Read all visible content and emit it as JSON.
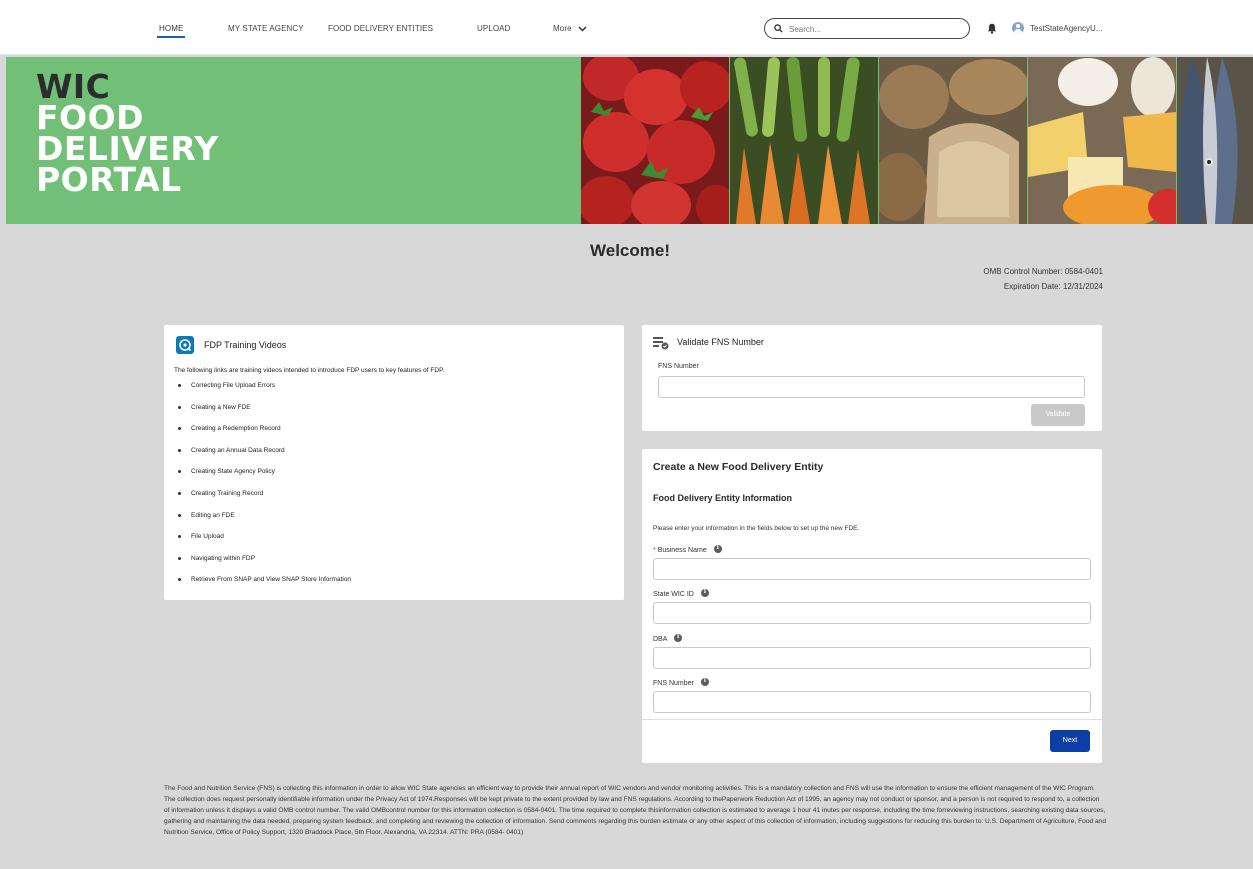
{
  "nav": {
    "items": [
      "HOME",
      "MY STATE AGENCY",
      "FOOD DELIVERY ENTITIES",
      "UPLOAD"
    ],
    "more_label": "More",
    "search_placeholder": "Search...",
    "username": "TestStateAgencyU..."
  },
  "banner": {
    "line1": "WIC",
    "line2": "FOOD",
    "line3": "DELIVERY",
    "line4": "PORTAL"
  },
  "welcome": {
    "title": "Welcome!",
    "omb_line": "OMB Control Number: 0584-0401",
    "expiration_line": "Expiration Date: 12/31/2024"
  },
  "training": {
    "title": "FDP Training Videos",
    "intro": "The following links are training videos intended to introduce FDP users to key features of FDP.",
    "links": [
      "Correcting File Upload Errors",
      "Creating a New FDE",
      "Creating a Redemption Record",
      "Creating an Annual Data Record",
      "Creating State Agency Policy",
      "Creating Training Record",
      "Editing an FDE",
      "File Upload",
      "Navigating within FDP",
      "Retrieve From SNAP and View SNAP Store Information"
    ]
  },
  "validate": {
    "title": "Validate FNS Number",
    "field_label": "FNS Number",
    "field_value": "",
    "button_label": "Validate"
  },
  "create": {
    "title": "Create a New Food Delivery Entity",
    "subtitle": "Food Delivery Entity Information",
    "intro": "Please enter your information in the fields below to set up the new FDE.",
    "required_mark": "*",
    "fields": [
      {
        "label": "Business Name",
        "value": ""
      },
      {
        "label": "State WIC ID",
        "value": ""
      },
      {
        "label": "DBA",
        "value": ""
      },
      {
        "label": "FNS Number",
        "value": ""
      }
    ],
    "next_label": "Next"
  },
  "footer": {
    "text": "The Food and Nutrition Service (FNS) is collecting this information in order to allow WIC State agencies an efficient way to provide their annual report of WIC vendors and vendor monitoring activities. This is a mandatory collection and FNS will use the information to ensure the efficient management of the WIC Program. The collection does request personally identifiable information under the Privacy Act of 1974.Responses will be kept private to the extent provided by law and FNS regulations. According to thePaperwork Reduction Act of 1995, an agency may not conduct or sponsor, and a person is not required to respond to, a collection of information unless it displays a valid OMB control number. The valid OMBcontrol number for this information collection is 0584-0401. The time required to complete thisinformation collection is estimated to average 1 hour 41 inutes per response, including the time forreviewing instructions, searching existing data sources, gathering and maintaining the data needed, preparing system feedback, and completing and reviewing the collection of information. Send comments regarding this burden estimate or any other aspect of this collection of information, including suggestions for reducing this burden to: U.S. Department of Agriculture, Food and Nutrition Service, Office of Policy Support, 1320 Braddock Place, 5th Floor, Alexandria, VA 22314. ATTN: PRA (0584- 0401)"
  },
  "colors": {
    "banner_green": "#72c078",
    "primary_button": "#0b3fa6",
    "nav_active_underline": "#1a5fb4",
    "page_background": "#d8d8d8"
  }
}
